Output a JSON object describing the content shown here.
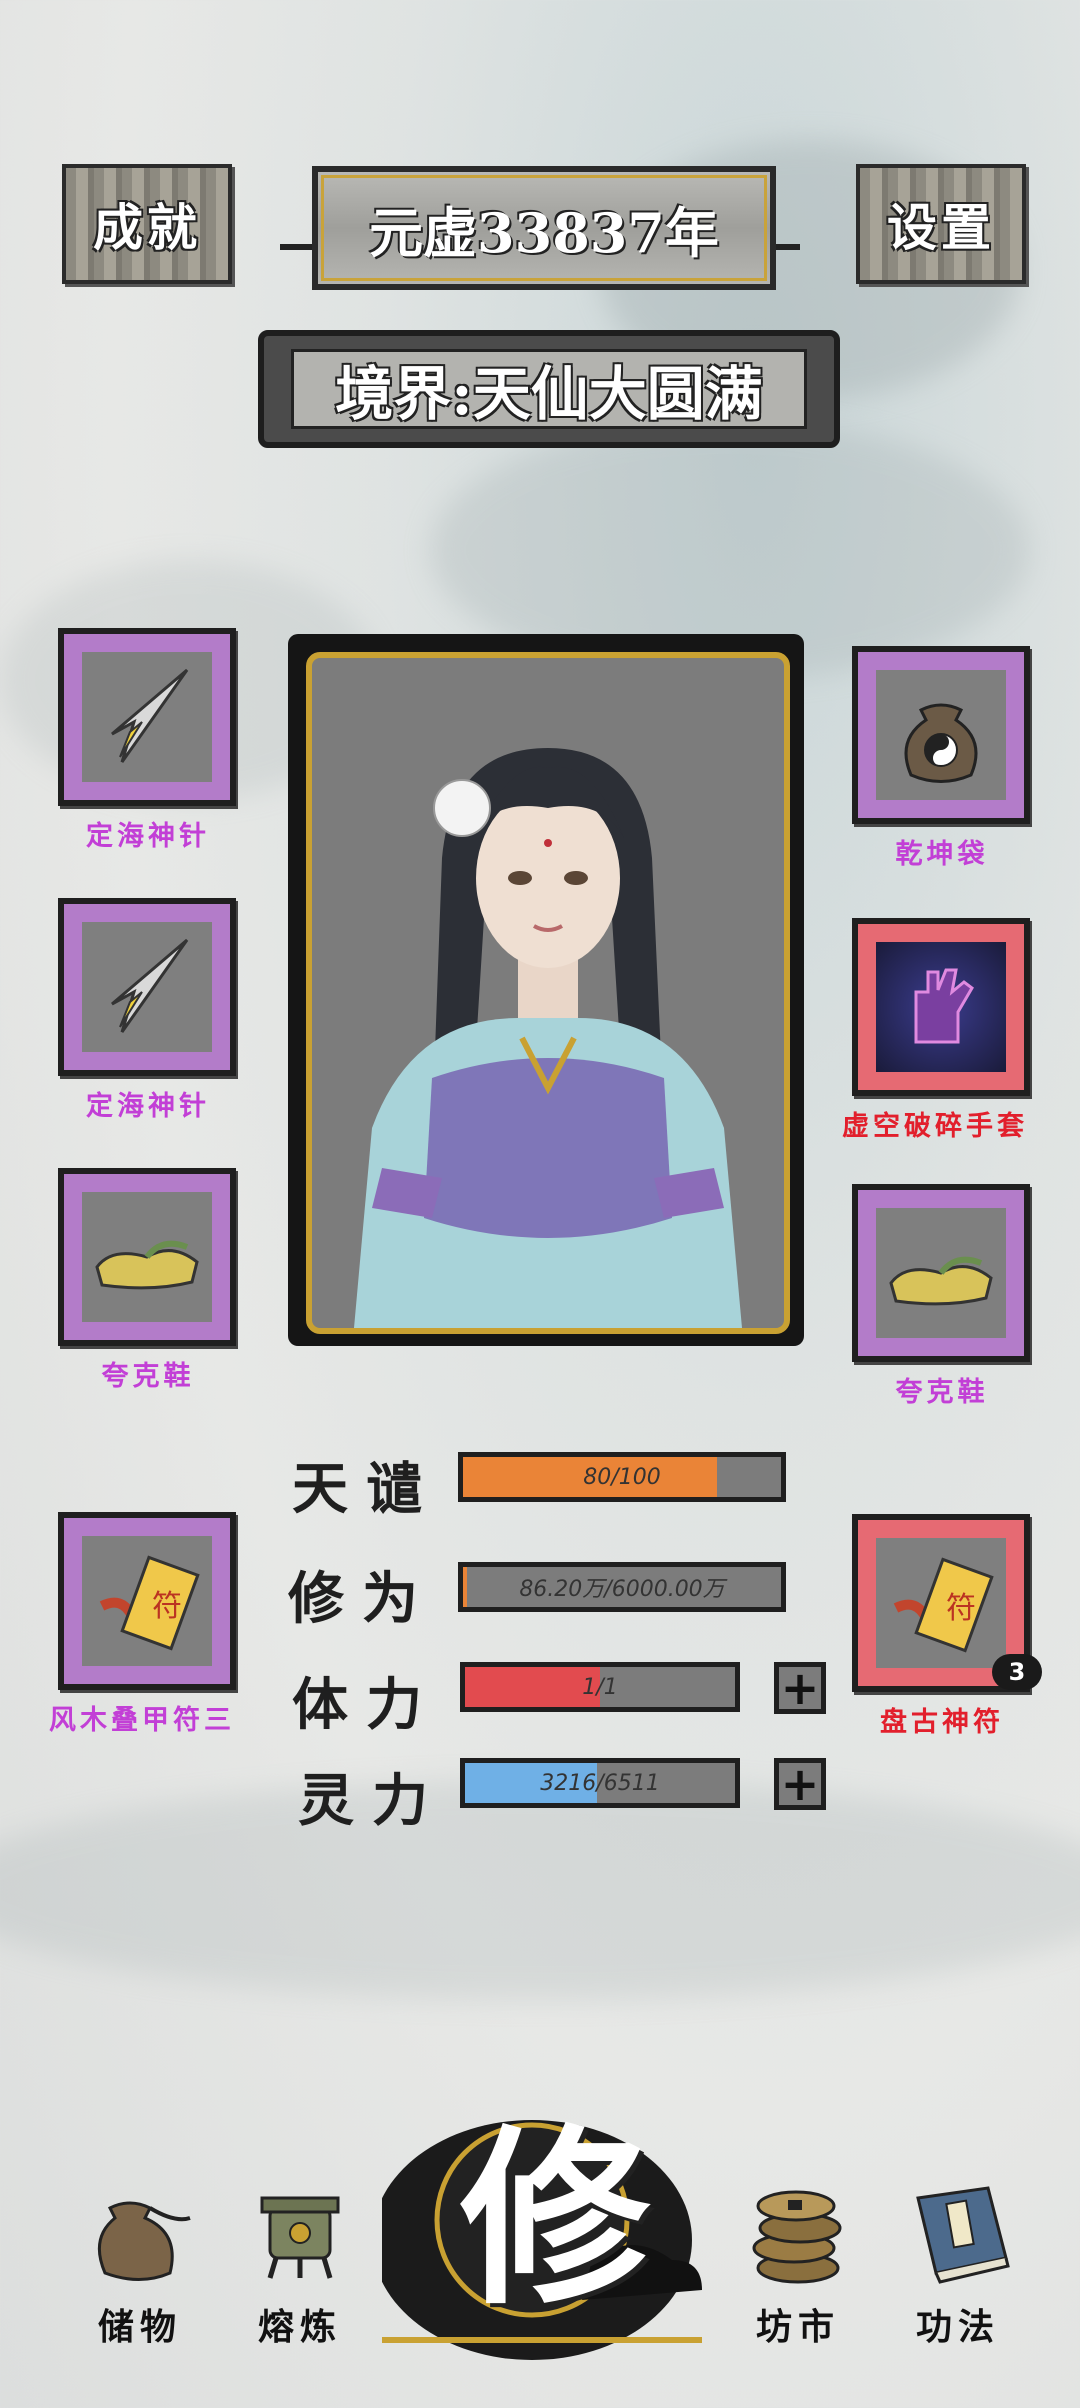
{
  "header": {
    "achievements_label": "成就",
    "year_label": "元虚33837年",
    "settings_label": "设置",
    "realm_label": "境界:天仙大圆满"
  },
  "equipment": {
    "left": [
      {
        "name": "定海神针",
        "icon": "needle-icon",
        "rarity": "purple"
      },
      {
        "name": "定海神针",
        "icon": "needle-icon",
        "rarity": "purple"
      },
      {
        "name": "夸克鞋",
        "icon": "shoe-icon",
        "rarity": "purple"
      },
      {
        "name": "风木叠甲符三",
        "icon": "talisman-icon",
        "rarity": "purple"
      }
    ],
    "right": [
      {
        "name": "乾坤袋",
        "icon": "bag-icon",
        "rarity": "purple"
      },
      {
        "name": "虚空破碎手套",
        "icon": "glove-icon",
        "rarity": "red"
      },
      {
        "name": "夸克鞋",
        "icon": "shoe-icon",
        "rarity": "purple"
      },
      {
        "name": "盘古神符",
        "icon": "talisman-icon",
        "rarity": "red",
        "count": "3"
      }
    ]
  },
  "stats": {
    "tribulation": {
      "label": "天谴",
      "text": "80/100",
      "fraction": 0.8,
      "color": "#ea8437"
    },
    "cultivation": {
      "label": "修为",
      "text": "86.20万/6000.00万",
      "fraction": 0.014,
      "color": "#ea8437"
    },
    "stamina": {
      "label": "体力",
      "text": "1/1",
      "fraction": 0.5,
      "color": "#e24b4f"
    },
    "spirit": {
      "label": "灵力",
      "text": "3216/6511",
      "fraction": 0.49,
      "color": "#6fb0e6"
    }
  },
  "nav": {
    "storage": "储物",
    "smelt": "熔炼",
    "cultivate": "修",
    "market": "坊市",
    "techniques": "功法"
  },
  "colors": {
    "purple_frame": "#b37cc9",
    "red_frame": "#e66a73",
    "gold_trim": "#c9a132"
  }
}
